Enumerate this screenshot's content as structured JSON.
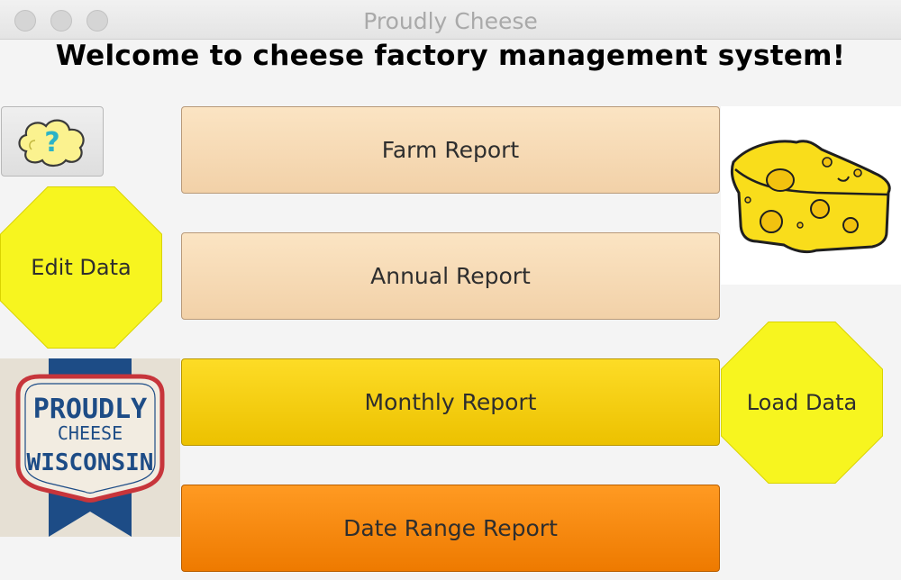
{
  "window": {
    "title": "Proudly Cheese"
  },
  "welcome": "Welcome to cheese factory management system!",
  "reports": {
    "farm": "Farm Report",
    "annual": "Annual Report",
    "monthly": "Monthly Report",
    "range": "Date Range Report"
  },
  "actions": {
    "edit": "Edit Data",
    "load": "Load Data"
  },
  "help": {
    "icon": "question-cloud-icon",
    "glyph": "?"
  },
  "logo": {
    "line1": "PROUDLY",
    "line2": "CHEESE",
    "line3": "WISCONSIN"
  },
  "colors": {
    "light_button": "#f7dcb6",
    "monthly_button": "#f6cf12",
    "range_button": "#f88712",
    "octagon": "#f7f51f",
    "cheese": "#f9dd1b"
  }
}
